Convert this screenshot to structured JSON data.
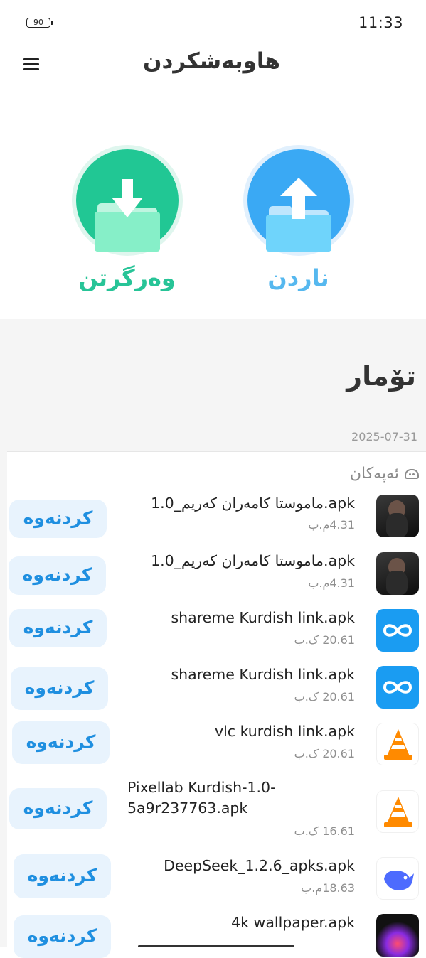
{
  "status_bar": {
    "battery": "90",
    "time": "11:33"
  },
  "header": {
    "title": "هاوبەشکردن",
    "menu_icon": "hamburger-menu-icon"
  },
  "actions": {
    "receive": {
      "label": "وەرگرتن",
      "icon": "download-folder-icon",
      "color": "#21c794"
    },
    "send": {
      "label": "ناردن",
      "icon": "upload-folder-icon",
      "color": "#3aa9f4"
    }
  },
  "history": {
    "title": "تۆمار",
    "date": "2025-07-31",
    "category": "ئەپەکان",
    "category_icon": "android-icon",
    "open_label": "کردنەوە",
    "items": [
      {
        "name": "ماموستا کامەران کەریم_1.0.apk",
        "size": "4.31م.ب",
        "icon": "kameran-karim-avatar-icon"
      },
      {
        "name": "ماموستا کامەران کەریم_1.0.apk",
        "size": "4.31م.ب",
        "icon": "kameran-karim-avatar-icon"
      },
      {
        "name": "shareme Kurdish link.apk",
        "size": "20.61 ک.ب",
        "icon": "shareme-icon"
      },
      {
        "name": "shareme Kurdish link.apk",
        "size": "20.61 ک.ب",
        "icon": "shareme-icon"
      },
      {
        "name": "vlc kurdish link.apk",
        "size": "20.61 ک.ب",
        "icon": "vlc-cone-icon"
      },
      {
        "name": "Pixellab Kurdish-1.0-5a9r237763.apk",
        "size": "16.61 ک.ب",
        "icon": "vlc-cone-icon"
      },
      {
        "name": "DeepSeek_1.2.6_apks.apk",
        "size": "18.63م.ب",
        "icon": "deepseek-whale-icon"
      },
      {
        "name": "4k wallpaper.apk",
        "size": "",
        "icon": "wallpaper-app-icon"
      }
    ]
  },
  "colors": {
    "accent_blue": "#1f8fe0",
    "button_bg": "#e8f3fd",
    "section_bg": "#f5f5f5"
  }
}
